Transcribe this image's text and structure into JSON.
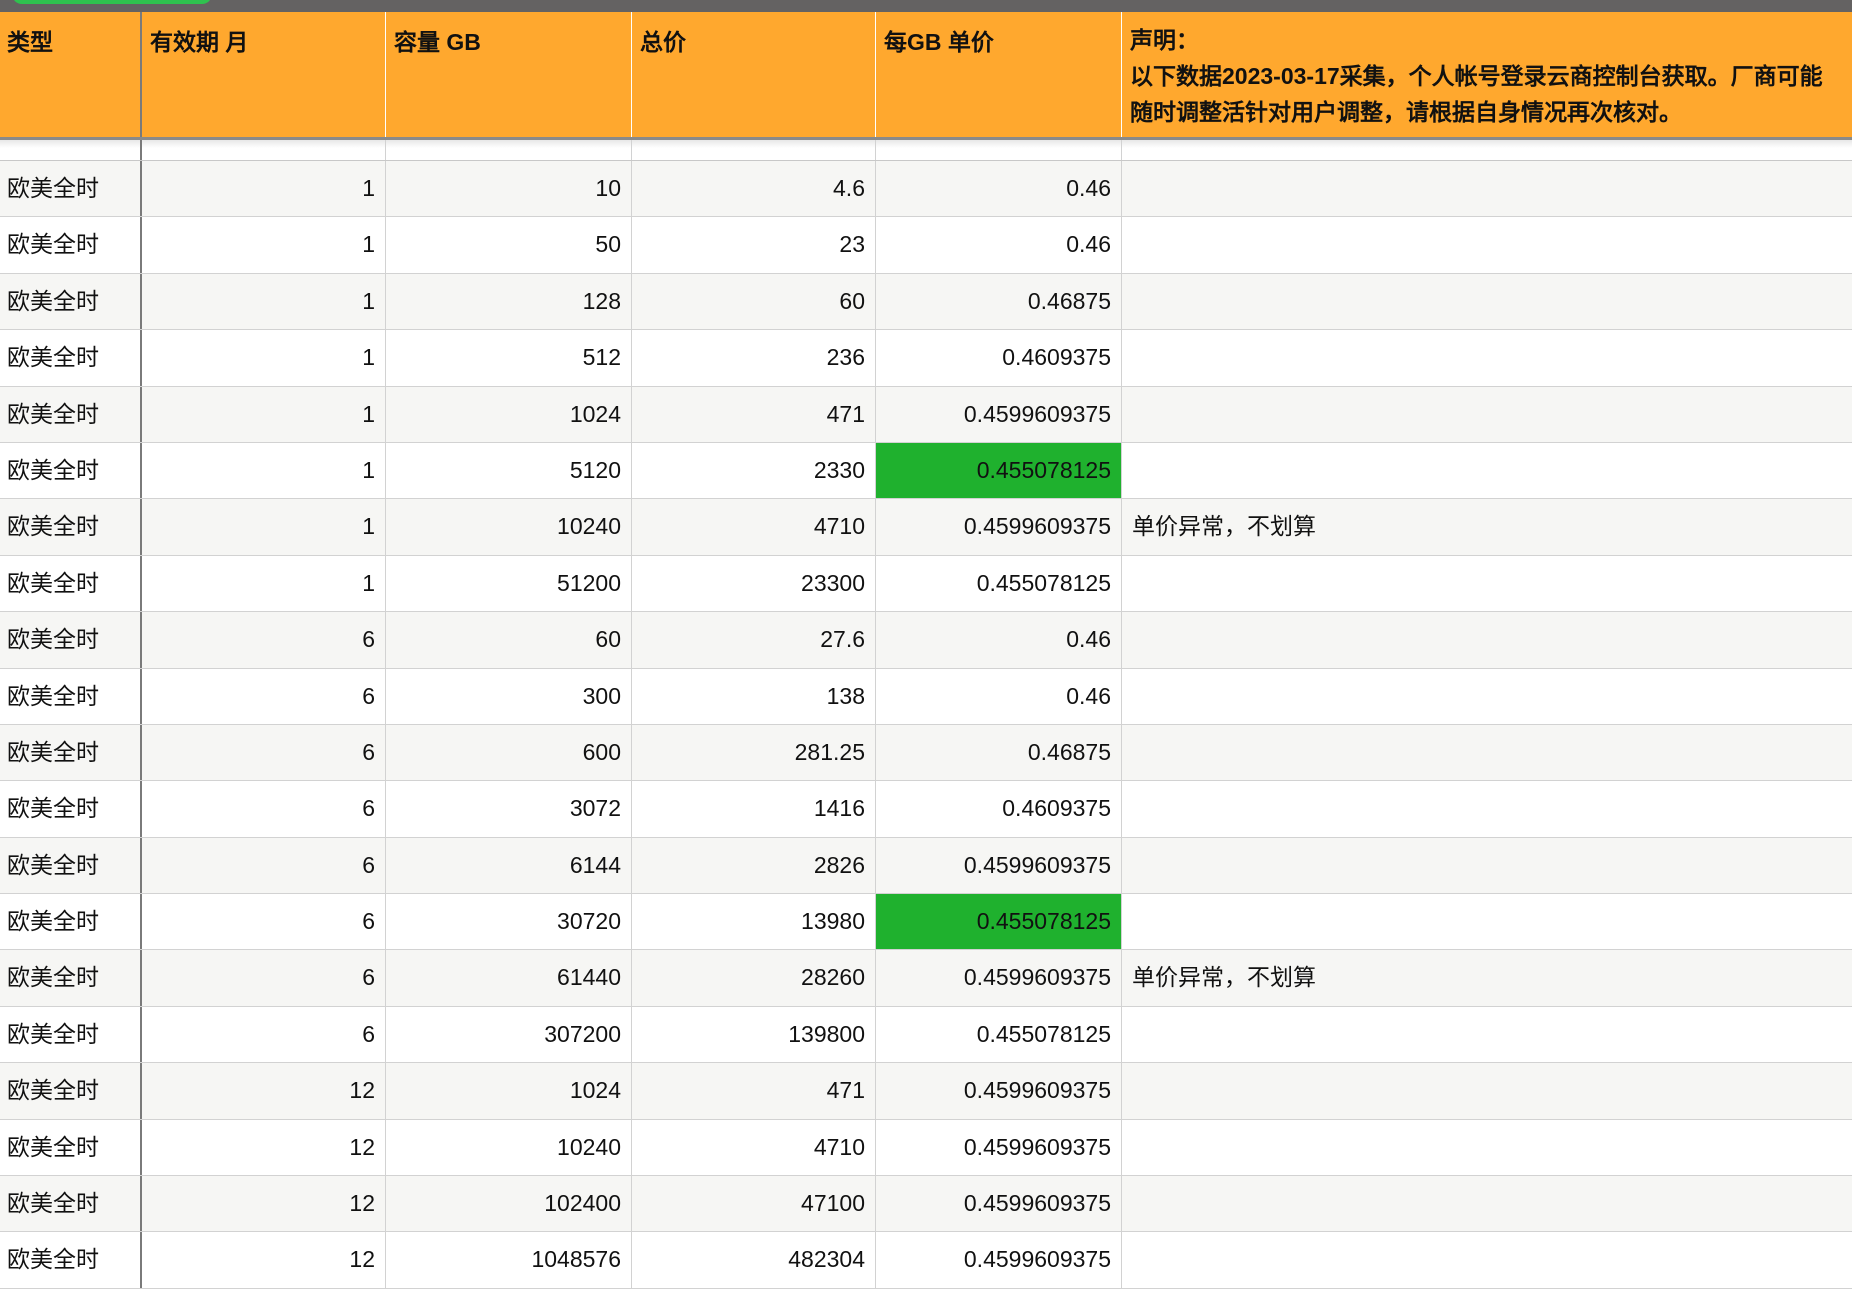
{
  "headers": [
    "类型",
    "有效期  月",
    "容量 GB",
    "总价",
    "每GB 单价"
  ],
  "notice": {
    "title": "声明：",
    "body": "以下数据2023-03-17采集，个人帐号登录云商控制台获取。厂商可能随时调整活针对用户调整，请根据自身情况再次核对。"
  },
  "highlight_color": "#1fb12e",
  "rows": [
    {
      "type": "欧美全时",
      "months": "1",
      "gb": "10",
      "total": "4.6",
      "unit": "0.46",
      "note": "",
      "hl": false
    },
    {
      "type": "欧美全时",
      "months": "1",
      "gb": "50",
      "total": "23",
      "unit": "0.46",
      "note": "",
      "hl": false
    },
    {
      "type": "欧美全时",
      "months": "1",
      "gb": "128",
      "total": "60",
      "unit": "0.46875",
      "note": "",
      "hl": false
    },
    {
      "type": "欧美全时",
      "months": "1",
      "gb": "512",
      "total": "236",
      "unit": "0.4609375",
      "note": "",
      "hl": false
    },
    {
      "type": "欧美全时",
      "months": "1",
      "gb": "1024",
      "total": "471",
      "unit": "0.4599609375",
      "note": "",
      "hl": false
    },
    {
      "type": "欧美全时",
      "months": "1",
      "gb": "5120",
      "total": "2330",
      "unit": "0.455078125",
      "note": "",
      "hl": true
    },
    {
      "type": "欧美全时",
      "months": "1",
      "gb": "10240",
      "total": "4710",
      "unit": "0.4599609375",
      "note": "单价异常，不划算",
      "hl": false
    },
    {
      "type": "欧美全时",
      "months": "1",
      "gb": "51200",
      "total": "23300",
      "unit": "0.455078125",
      "note": "",
      "hl": false
    },
    {
      "type": "欧美全时",
      "months": "6",
      "gb": "60",
      "total": "27.6",
      "unit": "0.46",
      "note": "",
      "hl": false
    },
    {
      "type": "欧美全时",
      "months": "6",
      "gb": "300",
      "total": "138",
      "unit": "0.46",
      "note": "",
      "hl": false
    },
    {
      "type": "欧美全时",
      "months": "6",
      "gb": "600",
      "total": "281.25",
      "unit": "0.46875",
      "note": "",
      "hl": false
    },
    {
      "type": "欧美全时",
      "months": "6",
      "gb": "3072",
      "total": "1416",
      "unit": "0.4609375",
      "note": "",
      "hl": false
    },
    {
      "type": "欧美全时",
      "months": "6",
      "gb": "6144",
      "total": "2826",
      "unit": "0.4599609375",
      "note": "",
      "hl": false
    },
    {
      "type": "欧美全时",
      "months": "6",
      "gb": "30720",
      "total": "13980",
      "unit": "0.455078125",
      "note": "",
      "hl": true
    },
    {
      "type": "欧美全时",
      "months": "6",
      "gb": "61440",
      "total": "28260",
      "unit": "0.4599609375",
      "note": "单价异常，不划算",
      "hl": false
    },
    {
      "type": "欧美全时",
      "months": "6",
      "gb": "307200",
      "total": "139800",
      "unit": "0.455078125",
      "note": "",
      "hl": false
    },
    {
      "type": "欧美全时",
      "months": "12",
      "gb": "1024",
      "total": "471",
      "unit": "0.4599609375",
      "note": "",
      "hl": false
    },
    {
      "type": "欧美全时",
      "months": "12",
      "gb": "10240",
      "total": "4710",
      "unit": "0.4599609375",
      "note": "",
      "hl": false
    },
    {
      "type": "欧美全时",
      "months": "12",
      "gb": "102400",
      "total": "47100",
      "unit": "0.4599609375",
      "note": "",
      "hl": false
    },
    {
      "type": "欧美全时",
      "months": "12",
      "gb": "1048576",
      "total": "482304",
      "unit": "0.4599609375",
      "note": "",
      "hl": false
    }
  ]
}
